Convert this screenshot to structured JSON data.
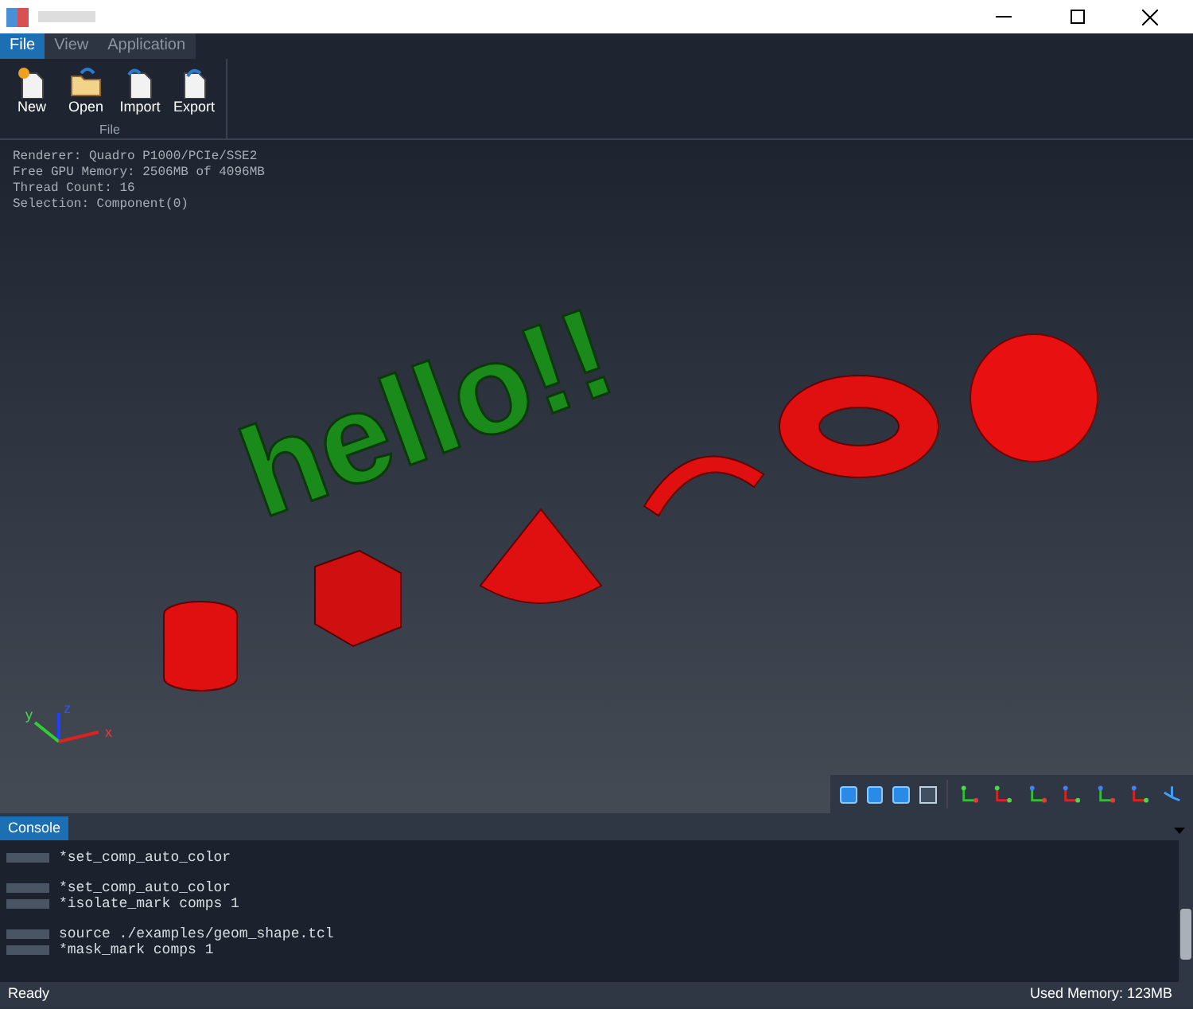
{
  "menu_tabs": [
    {
      "label": "File",
      "selected": true
    },
    {
      "label": "View",
      "selected": false
    },
    {
      "label": "Application",
      "selected": false
    }
  ],
  "ribbon": {
    "buttons": [
      {
        "label": "New",
        "kind": "new"
      },
      {
        "label": "Open",
        "kind": "open"
      },
      {
        "label": "Import",
        "kind": "import"
      },
      {
        "label": "Export",
        "kind": "export"
      }
    ],
    "group_label": "File"
  },
  "viewport": {
    "info_lines": [
      "Renderer: Quadro P1000/PCIe/SSE2",
      "Free GPU Memory: 2506MB of 4096MB",
      "Thread Count: 16",
      "Selection: Component(0)"
    ],
    "scene_text": "hello!!",
    "axes": [
      "z",
      "y",
      "x"
    ]
  },
  "console": {
    "tab": "Console",
    "blocks": [
      [
        "*set_comp_auto_color"
      ],
      [
        "*set_comp_auto_color",
        "*isolate_mark comps 1"
      ],
      [
        "source ./examples/geom_shape.tcl",
        "*mask_mark comps 1"
      ]
    ]
  },
  "status_bar": {
    "left": "Ready",
    "right": "Used Memory: 123MB"
  }
}
